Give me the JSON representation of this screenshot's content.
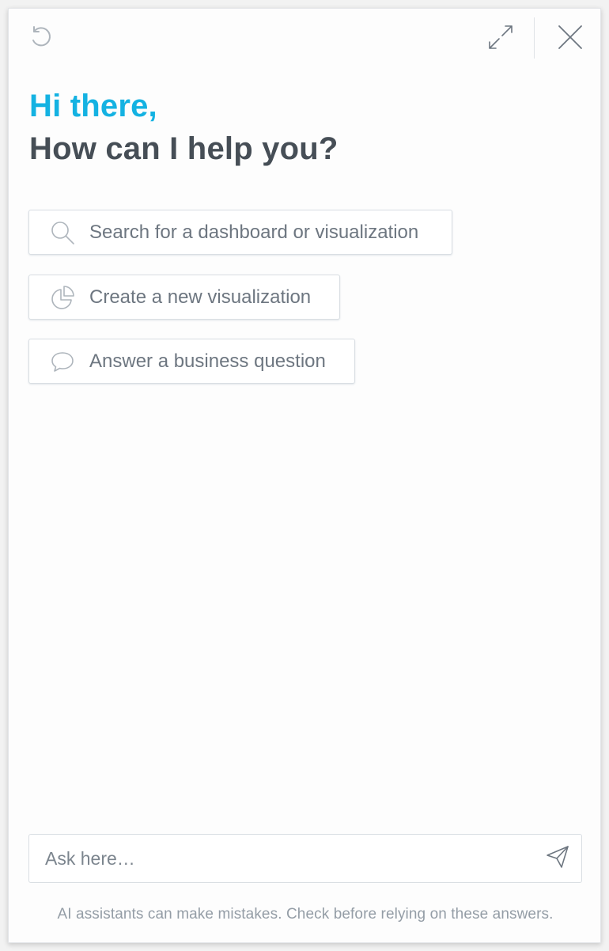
{
  "header": {
    "reset_icon": "reset-icon",
    "expand_icon": "expand-icon",
    "close_icon": "close-icon"
  },
  "greeting": {
    "line1": "Hi there,",
    "line2": "How can I help you?"
  },
  "actions": [
    {
      "label": "Search for a dashboard or visualization",
      "icon": "search-icon"
    },
    {
      "label": "Create a new visualization",
      "icon": "pie-chart-icon"
    },
    {
      "label": "Answer a business question",
      "icon": "chat-bubble-icon"
    }
  ],
  "ask": {
    "placeholder": "Ask here…",
    "send_icon": "send-icon"
  },
  "disclaimer": "AI assistants can make mistakes. Check before relying on these answers.",
  "colors": {
    "accent": "#14b2e2",
    "heading": "#464e56",
    "muted_text": "#6d7680",
    "border": "#d9dee3"
  }
}
